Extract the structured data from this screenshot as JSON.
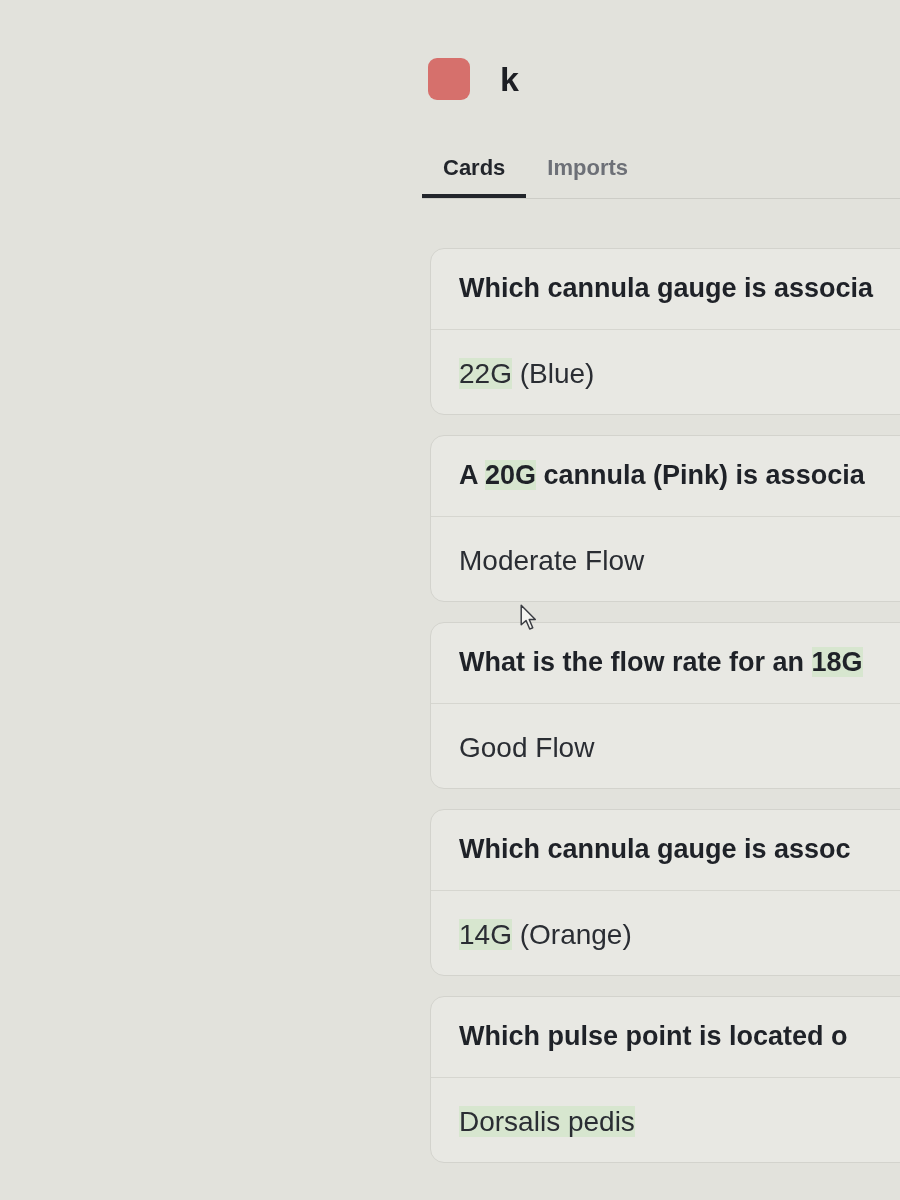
{
  "deck": {
    "name": "k"
  },
  "tabs": [
    {
      "label": "Cards",
      "selected": true
    },
    {
      "label": "Imports",
      "selected": false
    }
  ],
  "cards": [
    {
      "question": [
        {
          "text": "Which cannula gauge is associa",
          "highlighted": false
        }
      ],
      "answer": [
        {
          "text": "22G",
          "highlighted": true
        },
        {
          "text": " (Blue)",
          "highlighted": false
        }
      ]
    },
    {
      "question": [
        {
          "text": "A ",
          "highlighted": false
        },
        {
          "text": "20G",
          "highlighted": true
        },
        {
          "text": " cannula (Pink) is associa",
          "highlighted": false
        }
      ],
      "answer": [
        {
          "text": "Moderate Flow",
          "highlighted": false
        }
      ]
    },
    {
      "question": [
        {
          "text": "What is the flow rate for an ",
          "highlighted": false
        },
        {
          "text": "18G",
          "highlighted": true
        }
      ],
      "answer": [
        {
          "text": "Good Flow",
          "highlighted": false
        }
      ]
    },
    {
      "question": [
        {
          "text": "Which cannula gauge is assoc",
          "highlighted": false
        }
      ],
      "answer": [
        {
          "text": "14G",
          "highlighted": true
        },
        {
          "text": " (Orange)",
          "highlighted": false
        }
      ]
    },
    {
      "question": [
        {
          "text": "Which pulse point is located o",
          "highlighted": false
        }
      ],
      "answer": [
        {
          "text": "Dorsalis pedis",
          "highlighted": true
        }
      ]
    }
  ]
}
